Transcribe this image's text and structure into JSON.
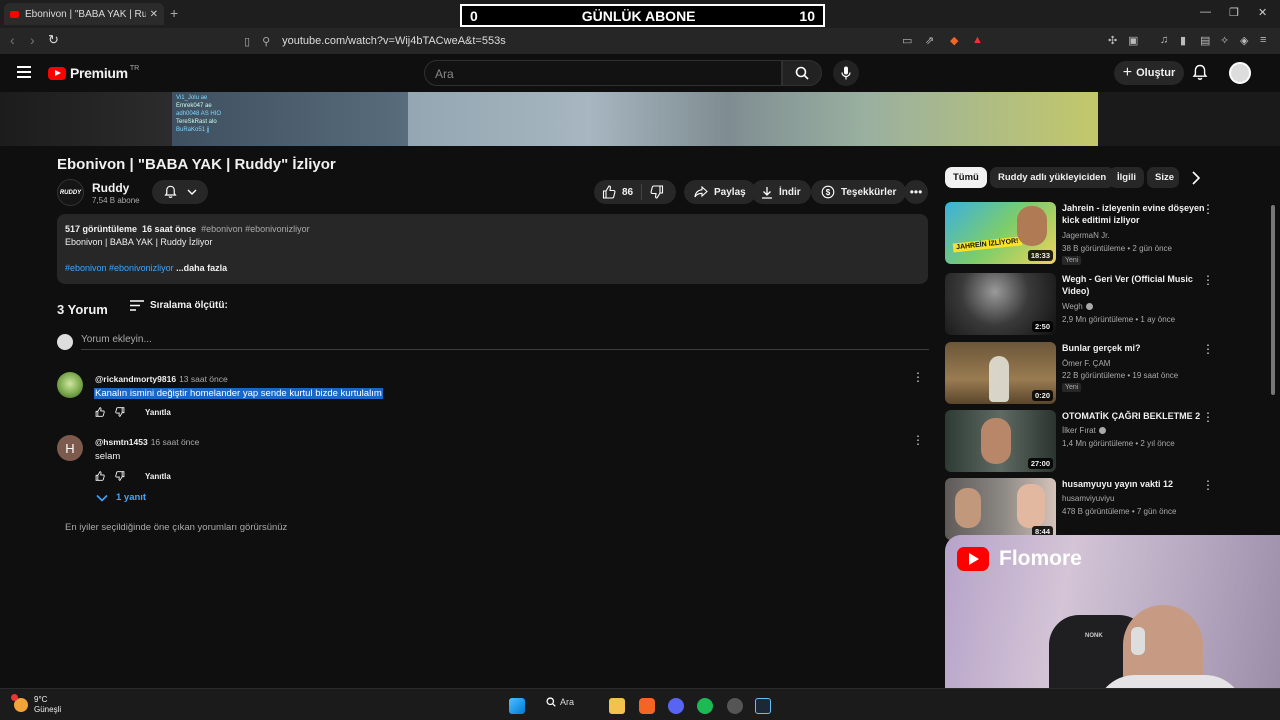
{
  "browser": {
    "tab_title": "Ebonivon | \"BABA YAK | Ruddy\" İ",
    "url": "youtube.com/watch?v=Wij4bTACweA&t=553s"
  },
  "overlay": {
    "left": "0",
    "label": "GÜNLÜK ABONE",
    "right": "10"
  },
  "header": {
    "brand": "Premium",
    "region": "TR",
    "search_placeholder": "Ara",
    "create_label": "Oluştur"
  },
  "stream_chat": [
    "Vi1_Jolu ae",
    "Emrek047 ae",
    "adh0048 AS HIO",
    "TereSkRast alo",
    "BuRaKo51 jj"
  ],
  "video": {
    "title": "Ebonivon | \"BABA YAK | Ruddy\" İzliyor",
    "channel": "Ruddy",
    "channel_logo": "RUDDY",
    "subscribers": "7,54 B abone",
    "likes": "86",
    "share_label": "Paylaş",
    "download_label": "İndir",
    "thanks_label": "Teşekkürler"
  },
  "description": {
    "views": "517 görüntüleme",
    "age": "16 saat önce",
    "tags": "#ebonivon #ebonivonizliyor",
    "line1": "Ebonivon | BABA YAK | Ruddy İzliyor",
    "hashtags": "#ebonivon #ebonivonizliyor",
    "more": "...daha fazla"
  },
  "comments": {
    "count_label": "3 Yorum",
    "sort_label": "Sıralama ölçütü:",
    "add_placeholder": "Yorum ekleyin...",
    "reply_label": "Yanıtla",
    "items": [
      {
        "author": "@rickandmorty9816",
        "time": "13 saat önce",
        "text": "Kanalın ismini değiştir homelander yap sende kurtul bizde kurtulalım"
      },
      {
        "author": "@hsmtn1453",
        "time": "16 saat önce",
        "text": "selam",
        "avatar_letter": "H"
      }
    ],
    "replies_label": "1 yanıt",
    "footer_note": "En iyiler seçildiğinde öne çıkan yorumları görürsünüz"
  },
  "chips": [
    "Tümü",
    "Ruddy adlı yükleyiciden",
    "İlgili",
    "Size"
  ],
  "recommendations": [
    {
      "title": "Jahrein - izleyenin evine döşeyen kick editimi izliyor",
      "channel": "JagermaN Jr.",
      "meta": "38 B görüntüleme • 2 gün önce",
      "badge": "Yeni",
      "duration": "18:33",
      "thumb_text": "JAHREİN İZLİYOR!"
    },
    {
      "title": "Wegh - Geri Ver (Official Music Video)",
      "channel": "Wegh",
      "meta": "2,9 Mn görüntüleme • 1 ay önce",
      "duration": "2:50"
    },
    {
      "title": "Bunlar gerçek mi?",
      "channel": "Ömer F. ÇAM",
      "meta": "22 B görüntüleme • 19 saat önce",
      "badge": "Yeni",
      "duration": "0:20"
    },
    {
      "title": "OTOMATİK ÇAĞRI BEKLETME 2",
      "channel": "İlker Fırat",
      "meta": "1,4 Mn görüntüleme • 2 yıl önce",
      "duration": "27:00"
    },
    {
      "title": "husamyuyu yayın vakti 12",
      "channel": "husamviyuviyu",
      "meta": "478 B görüntüleme • 7 gün önce",
      "duration": "8:44"
    }
  ],
  "webcam": {
    "logo_text": "Flomore",
    "chair_text": "NONK"
  },
  "taskbar": {
    "temp": "9°C",
    "weather": "Güneşli",
    "search_label": "Ara"
  }
}
